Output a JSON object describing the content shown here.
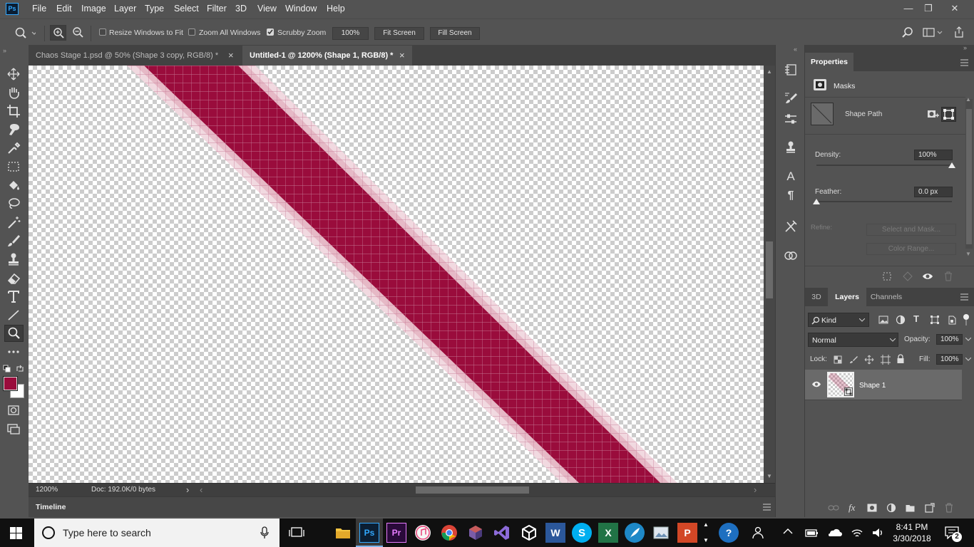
{
  "app": {
    "logo": "Ps"
  },
  "menu": [
    "File",
    "Edit",
    "Image",
    "Layer",
    "Type",
    "Select",
    "Filter",
    "3D",
    "View",
    "Window",
    "Help"
  ],
  "window_controls": {
    "minimize": "—",
    "restore": "❐",
    "close": "✕"
  },
  "options_bar": {
    "resize_windows_label": "Resize Windows to Fit",
    "resize_windows_checked": false,
    "zoom_all_label": "Zoom All Windows",
    "zoom_all_checked": false,
    "scrubby_label": "Scrubby Zoom",
    "scrubby_checked": true,
    "zoom_value": "100%",
    "fit_screen": "Fit Screen",
    "fill_screen": "Fill Screen"
  },
  "tabs": [
    {
      "label": "Chaos Stage 1.psd @ 50% (Shape 3 copy, RGB/8) *",
      "close": "×",
      "active": false
    },
    {
      "label": "Untitled-1 @ 1200% (Shape 1, RGB/8) *",
      "close": "×",
      "active": true
    }
  ],
  "status": {
    "zoom": "1200%",
    "doc": "Doc: 192.0K/0 bytes",
    "arrow": "›",
    "left_arrow": "‹",
    "right_arrow": "›"
  },
  "timeline": {
    "label": "Timeline"
  },
  "colors": {
    "foreground": "#9a0c3c",
    "background": "#ffffff",
    "shape": "#9a0c3c",
    "accent": "#31a8ff"
  },
  "properties": {
    "tab": "Properties",
    "masks_label": "Masks",
    "shape_path": "Shape Path",
    "density_label": "Density:",
    "density_value": "100%",
    "density_level": 1.0,
    "feather_label": "Feather:",
    "feather_value": "0.0 px",
    "feather_level": 0.0,
    "refine_label": "Refine:",
    "select_mask": "Select and Mask...",
    "color_range": "Color Range..."
  },
  "layers_panel": {
    "tabs": [
      "3D",
      "Layers",
      "Channels"
    ],
    "active_tab": "Layers",
    "filter_kind": "Kind",
    "blend_mode": "Normal",
    "opacity_label": "Opacity:",
    "opacity_value": "100%",
    "lock_label": "Lock:",
    "fill_label": "Fill:",
    "fill_value": "100%",
    "layers": [
      {
        "name": "Shape 1",
        "visible": true
      }
    ]
  },
  "taskbar": {
    "search_placeholder": "Type here to search",
    "time": "8:41 PM",
    "date": "3/30/2018",
    "notifications": "2"
  }
}
